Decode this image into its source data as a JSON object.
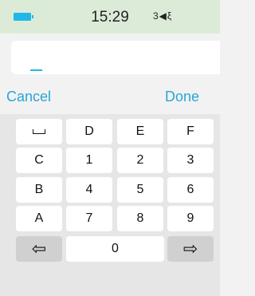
{
  "status": {
    "time": "15:29",
    "sound_icon": "speaker-icon",
    "battery_icon": "battery-icon"
  },
  "input": {
    "value": ""
  },
  "actions": {
    "cancel": "Cancel",
    "done": "Done"
  },
  "keyboard": {
    "rows": [
      [
        "␣",
        "D",
        "E",
        "F"
      ],
      [
        "C",
        "1",
        "2",
        "3"
      ],
      [
        "B",
        "4",
        "5",
        "6"
      ],
      [
        "A",
        "7",
        "8",
        "9"
      ]
    ],
    "bottom": {
      "left_arrow": "⇦",
      "zero": "0",
      "right_arrow": "⇨"
    }
  },
  "colors": {
    "accent": "#2aa5d8",
    "statusbar": "#dcebd8",
    "battery": "#1fb8e8"
  }
}
